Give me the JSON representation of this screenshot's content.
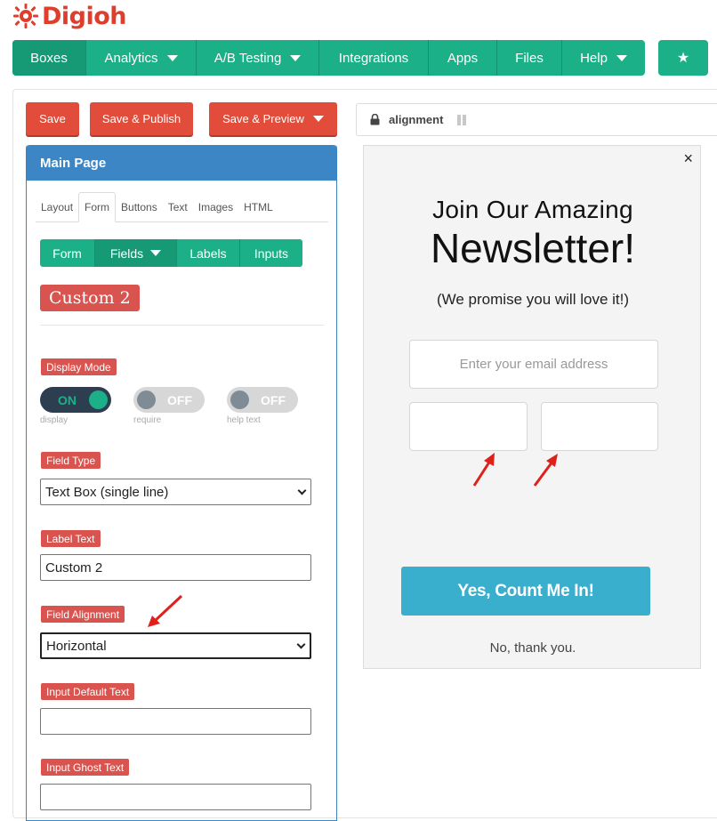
{
  "brand": {
    "name": "Digioh",
    "color": "#e03e2d"
  },
  "topnav": {
    "items": [
      {
        "label": "Boxes",
        "active": true
      },
      {
        "label": "Analytics",
        "dropdown": true
      },
      {
        "label": "A/B Testing",
        "dropdown": true
      },
      {
        "label": "Integrations"
      },
      {
        "label": "Apps"
      },
      {
        "label": "Files"
      },
      {
        "label": "Help",
        "dropdown": true
      }
    ],
    "star_icon": "star-icon"
  },
  "actions": {
    "save": "Save",
    "save_publish": "Save & Publish",
    "save_preview": "Save & Preview"
  },
  "panel": {
    "title": "Main Page",
    "tabs": [
      "Layout",
      "Form",
      "Buttons",
      "Text",
      "Images",
      "HTML"
    ],
    "active_tab": "Form",
    "subtabs": [
      "Form",
      "Fields",
      "Labels",
      "Inputs"
    ],
    "active_subtab": "Fields",
    "field_name": "Custom 2",
    "display_mode": {
      "label": "Display Mode",
      "toggles": [
        {
          "state": "ON",
          "caption": "display"
        },
        {
          "state": "OFF",
          "caption": "require"
        },
        {
          "state": "OFF",
          "caption": "help text"
        }
      ]
    },
    "field_type": {
      "label": "Field Type",
      "value": "Text Box (single line)"
    },
    "label_text": {
      "label": "Label Text",
      "value": "Custom 2"
    },
    "field_alignment": {
      "label": "Field Alignment",
      "value": "Horizontal"
    },
    "input_default": {
      "label": "Input Default Text",
      "value": ""
    },
    "input_ghost": {
      "label": "Input Ghost Text",
      "value": ""
    }
  },
  "preview": {
    "url_label": "alignment",
    "heading_line1": "Join Our Amazing",
    "heading_line2": "Newsletter!",
    "subheading": "(We promise you will love it!)",
    "email_placeholder": "Enter your email address",
    "cta": "Yes, Count Me In!",
    "decline": "No, thank you.",
    "close": "×"
  },
  "colors": {
    "nav_green": "#1cb088",
    "save_red": "#e24c3a",
    "panel_blue": "#3d86c6",
    "label_red": "#d9534f",
    "cta_blue": "#3aaecd",
    "annotation_arrow": "#e0201b"
  }
}
